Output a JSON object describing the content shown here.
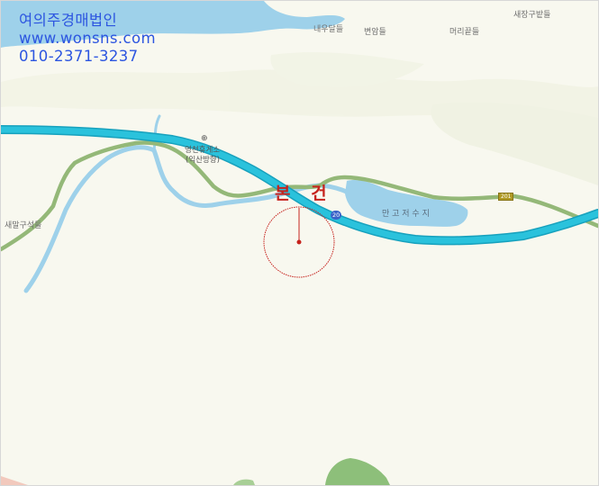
{
  "watermark": {
    "company": "여의주경매법인",
    "website": "www.wonsns.com",
    "phone": "010-2371-3237"
  },
  "place_labels": {
    "saejang": "새장구밭들",
    "naeul": "내우달들",
    "byeon": "변암들",
    "meori": "머리끝들",
    "rest_area": "영천휴게소",
    "rest_area_sub": "(익산방향)",
    "saemal": "새말구석들",
    "reservoir": "만 고 저 수 지"
  },
  "road_badges": {
    "highway": "20",
    "route": "201"
  },
  "subject": {
    "label": "본 건"
  },
  "colors": {
    "highway": "#21b6d1",
    "highway_edge": "#17a1bd",
    "local_road": "#94b878",
    "water": "#9ed1ea",
    "land": "#f8f8ef",
    "forest": "#8dbf7a",
    "marker": "#c6231d",
    "watermark": "#2c55e0"
  },
  "icons": {
    "rest_area": "rest-area-icon"
  }
}
